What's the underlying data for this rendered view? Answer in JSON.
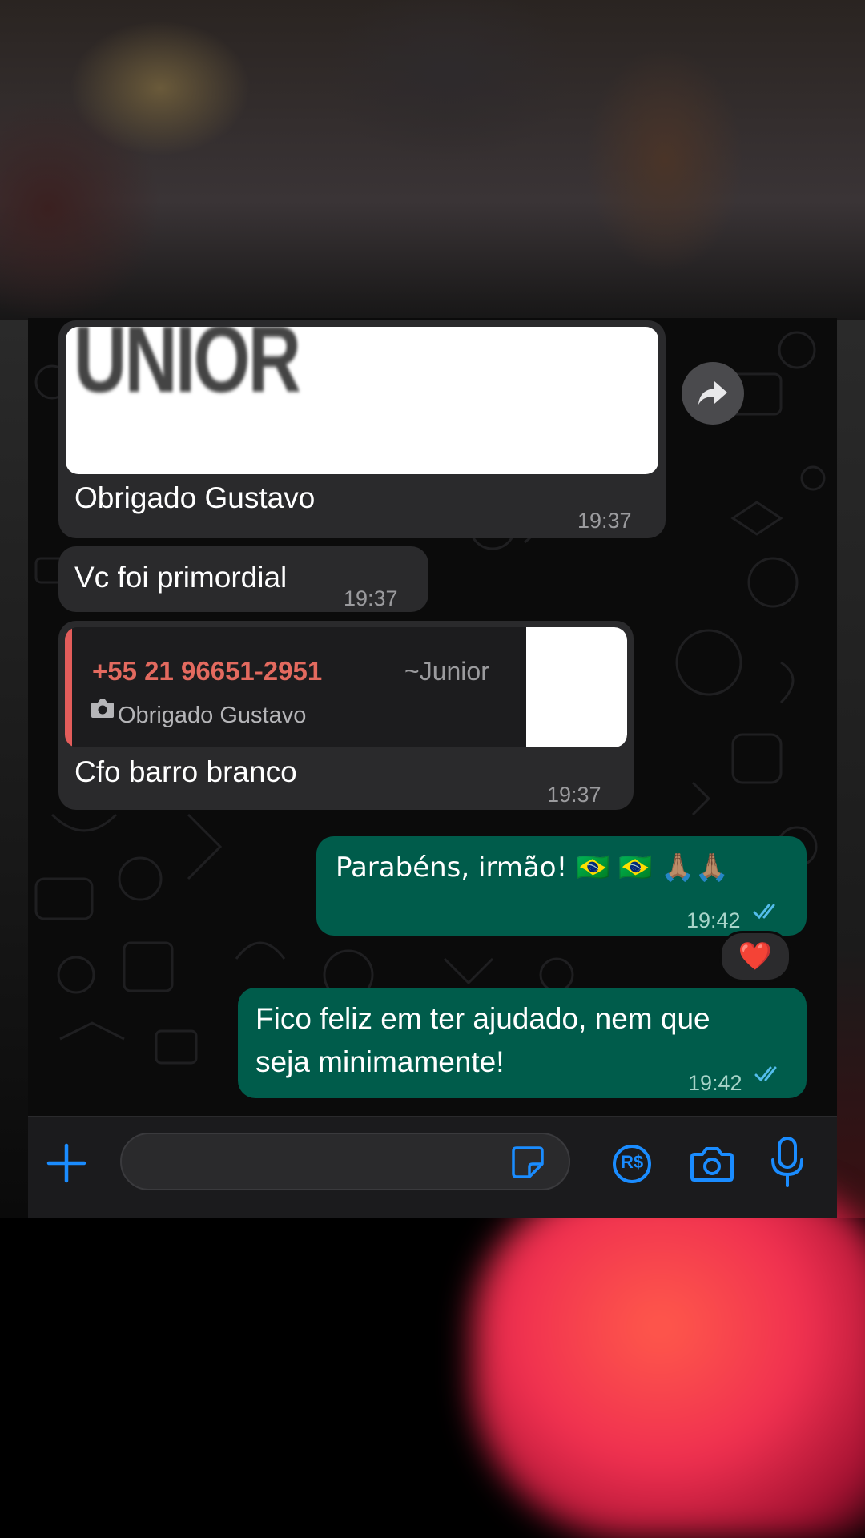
{
  "messages": [
    {
      "id": "m1",
      "direction": "incoming",
      "image_text": "UNIOR",
      "text": "Obrigado Gustavo",
      "time": "19:37"
    },
    {
      "id": "m2",
      "direction": "incoming",
      "text": "Vc foi primordial",
      "time": "19:37"
    },
    {
      "id": "m3",
      "direction": "incoming",
      "quote": {
        "phone": "+55 21 96651-2951",
        "alias": "~Junior",
        "text": "Obrigado Gustavo",
        "icon": "camera-icon"
      },
      "text": "Cfo barro branco",
      "time": "19:37"
    },
    {
      "id": "m4",
      "direction": "outgoing",
      "text": "Parabéns, irmão! 🇧🇷 🇧🇷 🙏🏽🙏🏽",
      "time": "19:42",
      "status": "read",
      "reaction": "❤️"
    },
    {
      "id": "m5",
      "direction": "outgoing",
      "lines": [
        "Fico feliz em ter ajudado, nem que",
        "seja minimamente!"
      ],
      "time": "19:42",
      "status": "read"
    }
  ],
  "input_bar": {
    "placeholder": "",
    "value": "",
    "icons": [
      "plus-icon",
      "sticker-icon",
      "payment-icon",
      "camera-icon",
      "microphone-icon"
    ],
    "payment_label": "R$"
  },
  "colors": {
    "incoming_bubble": "#2a2a2c",
    "outgoing_bubble": "#005c4b",
    "accent_blue": "#1a8cff",
    "quote_accent": "#e35d5b",
    "read_ticks": "#53bdeb"
  }
}
